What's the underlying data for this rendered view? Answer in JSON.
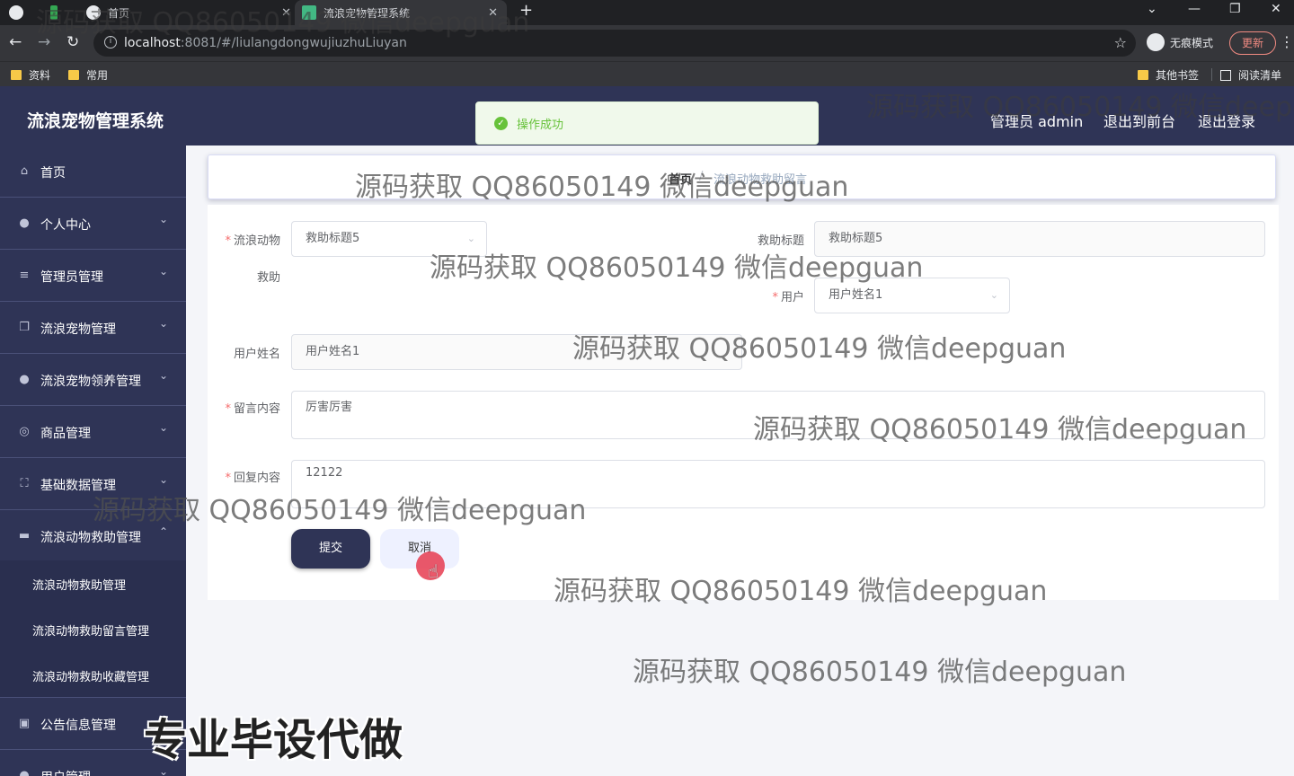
{
  "browser": {
    "tabs": [
      {
        "label": "首页",
        "active": false
      },
      {
        "label": "流浪宠物管理系统",
        "active": true
      }
    ],
    "url_host": "localhost",
    "url_path": ":8081/#/liulangdongwujiuzhuLiuyan",
    "incognito_label": "无痕模式",
    "update_label": "更新",
    "bookmarks": [
      "资料",
      "常用"
    ],
    "bookmarks_right": [
      "其他书签",
      "阅读清单"
    ]
  },
  "app": {
    "title": "流浪宠物管理系统",
    "header_links": {
      "admin": "管理员 admin",
      "front": "退出到前台",
      "logout": "退出登录"
    },
    "toast": "操作成功"
  },
  "sidebar": {
    "items": [
      {
        "label": "首页",
        "icon": "home-icon",
        "arrow": ""
      },
      {
        "label": "个人中心",
        "icon": "user-icon",
        "arrow": "⌄"
      },
      {
        "label": "管理员管理",
        "icon": "list-icon",
        "arrow": "⌄"
      },
      {
        "label": "流浪宠物管理",
        "icon": "copy-icon",
        "arrow": "⌄"
      },
      {
        "label": "流浪宠物领养管理",
        "icon": "user-icon",
        "arrow": "⌄"
      },
      {
        "label": "商品管理",
        "icon": "compass-icon",
        "arrow": "⌄"
      },
      {
        "label": "基础数据管理",
        "icon": "frame-icon",
        "arrow": "⌄"
      },
      {
        "label": "流浪动物救助管理",
        "icon": "briefcase-icon",
        "arrow": "⌃"
      }
    ],
    "sub_items": [
      "流浪动物救助管理",
      "流浪动物救助留言管理",
      "流浪动物救助收藏管理"
    ],
    "bottom_items": [
      {
        "label": "公告信息管理",
        "icon": "doc-icon"
      },
      {
        "label": "用户管理",
        "icon": "user-icon"
      }
    ]
  },
  "breadcrumb": {
    "home": "首页",
    "current": "流浪动物救助留言"
  },
  "form": {
    "animal_label": "流浪动物救助",
    "animal_label_1": "流浪动物",
    "animal_label_2": "救助",
    "animal_value": "救助标题5",
    "title_label": "救助标题",
    "title_value": "救助标题5",
    "user_label": "用户",
    "user_value": "用户姓名1",
    "username_label": "用户姓名",
    "username_value": "用户姓名1",
    "message_label": "留言内容",
    "message_value": "厉害厉害",
    "reply_label": "回复内容",
    "reply_value": "12122",
    "submit_label": "提交",
    "cancel_label": "取消"
  },
  "watermark": "源码获取 QQ86050149 微信deepguan",
  "promo_text": "专业毕设代做"
}
